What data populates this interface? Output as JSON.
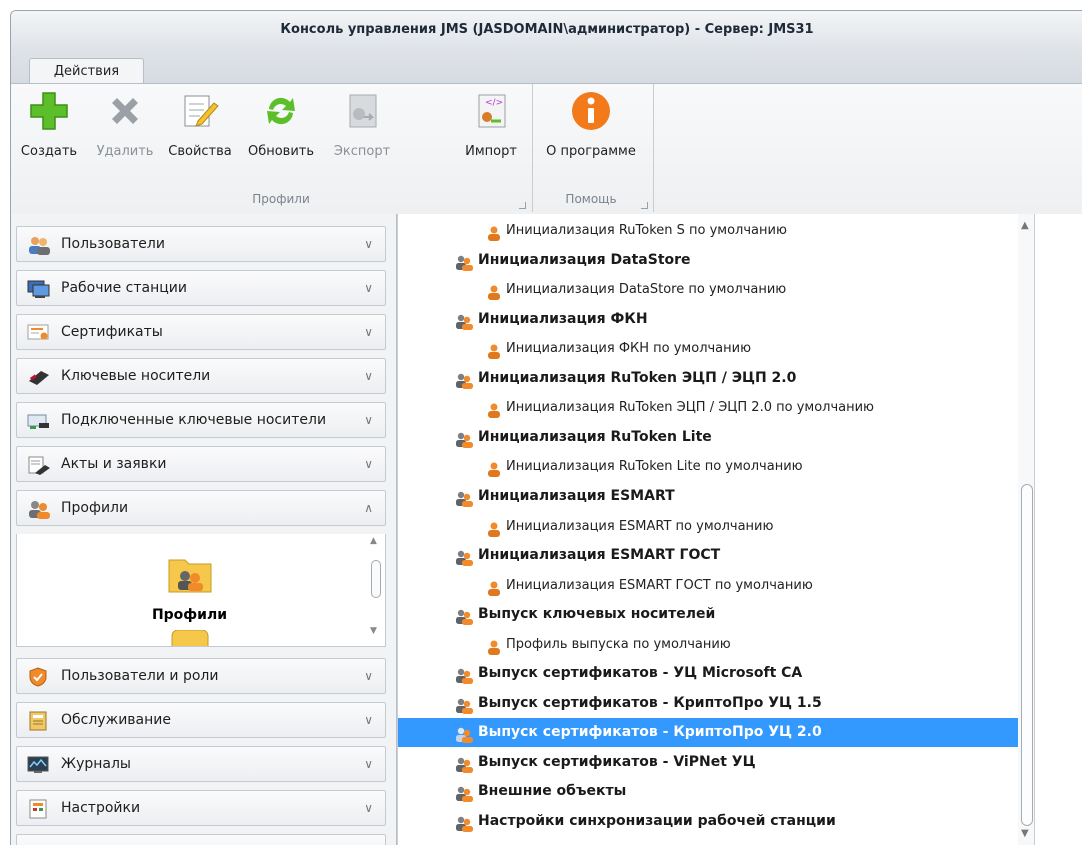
{
  "window": {
    "title": "Консоль управления JMS (JASDOMAIN\\администратор) - Сервер: JMS31"
  },
  "tabs": [
    {
      "label": "Действия",
      "active": true
    }
  ],
  "ribbon": {
    "buttons": [
      {
        "label": "Создать",
        "icon": "plus-icon",
        "enabled": true
      },
      {
        "label": "Удалить",
        "icon": "delete-x-icon",
        "enabled": false
      },
      {
        "label": "Свойства",
        "icon": "properties-edit-icon",
        "enabled": true
      },
      {
        "label": "Обновить",
        "icon": "refresh-icon",
        "enabled": true
      },
      {
        "label": "Экспорт",
        "icon": "export-icon",
        "enabled": false
      },
      {
        "label": "Импорт",
        "icon": "import-icon",
        "enabled": true
      },
      {
        "label": "О программе",
        "icon": "info-icon",
        "enabled": true
      }
    ],
    "groups": [
      {
        "label": "Профили"
      },
      {
        "label": "Помощь"
      }
    ]
  },
  "sidebar": {
    "items": [
      {
        "label": "Пользователи",
        "icon": "users-icon",
        "expanded": false
      },
      {
        "label": "Рабочие станции",
        "icon": "workstations-icon",
        "expanded": false
      },
      {
        "label": "Сертификаты",
        "icon": "certificate-icon",
        "expanded": false
      },
      {
        "label": "Ключевые носители",
        "icon": "token-icon",
        "expanded": false
      },
      {
        "label": "Подключенные ключевые носители",
        "icon": "connected-token-icon",
        "expanded": false
      },
      {
        "label": "Акты и заявки",
        "icon": "documents-icon",
        "expanded": false
      },
      {
        "label": "Профили",
        "icon": "profiles-icon",
        "expanded": true
      },
      {
        "label": "Пользователи и роли",
        "icon": "shield-icon",
        "expanded": false
      },
      {
        "label": "Обслуживание",
        "icon": "maintenance-icon",
        "expanded": false
      },
      {
        "label": "Журналы",
        "icon": "logs-icon",
        "expanded": false
      },
      {
        "label": "Настройки",
        "icon": "settings-icon",
        "expanded": false
      }
    ],
    "expanded_content": {
      "label": "Профили",
      "icon": "profiles-folder-icon"
    }
  },
  "tree": [
    {
      "text": "Инициализация RuToken S по умолчанию",
      "level": "child",
      "selected": false
    },
    {
      "text": "Инициализация DataStore",
      "level": "parent",
      "selected": false
    },
    {
      "text": "Инициализация DataStore по умолчанию",
      "level": "child",
      "selected": false
    },
    {
      "text": "Инициализация ФКН",
      "level": "parent",
      "selected": false
    },
    {
      "text": "Инициализация ФКН по умолчанию",
      "level": "child",
      "selected": false
    },
    {
      "text": "Инициализация RuToken ЭЦП / ЭЦП 2.0",
      "level": "parent",
      "selected": false
    },
    {
      "text": "Инициализация RuToken ЭЦП / ЭЦП 2.0 по умолчанию",
      "level": "child",
      "selected": false
    },
    {
      "text": "Инициализация RuToken Lite",
      "level": "parent",
      "selected": false
    },
    {
      "text": "Инициализация RuToken Lite по умолчанию",
      "level": "child",
      "selected": false
    },
    {
      "text": "Инициализация ESMART",
      "level": "parent",
      "selected": false
    },
    {
      "text": "Инициализация ESMART по умолчанию",
      "level": "child",
      "selected": false
    },
    {
      "text": "Инициализация ESMART ГОСТ",
      "level": "parent",
      "selected": false
    },
    {
      "text": "Инициализация ESMART ГОСТ по умолчанию",
      "level": "child",
      "selected": false
    },
    {
      "text": "Выпуск ключевых носителей",
      "level": "parent",
      "selected": false
    },
    {
      "text": "Профиль выпуска по умолчанию",
      "level": "child",
      "selected": false
    },
    {
      "text": "Выпуск сертификатов - УЦ Microsoft CA",
      "level": "parent",
      "selected": false
    },
    {
      "text": "Выпуск сертификатов - КриптоПро УЦ 1.5",
      "level": "parent",
      "selected": false
    },
    {
      "text": "Выпуск сертификатов - КриптоПро УЦ 2.0",
      "level": "parent",
      "selected": true
    },
    {
      "text": "Выпуск сертификатов - ViPNet УЦ",
      "level": "parent",
      "selected": false
    },
    {
      "text": "Внешние объекты",
      "level": "parent",
      "selected": false
    },
    {
      "text": "Настройки синхронизации рабочей станции",
      "level": "parent",
      "selected": false
    }
  ],
  "colors": {
    "selection": "#3399ff",
    "accent_orange": "#f27a1a",
    "green": "#5cbf2a"
  }
}
